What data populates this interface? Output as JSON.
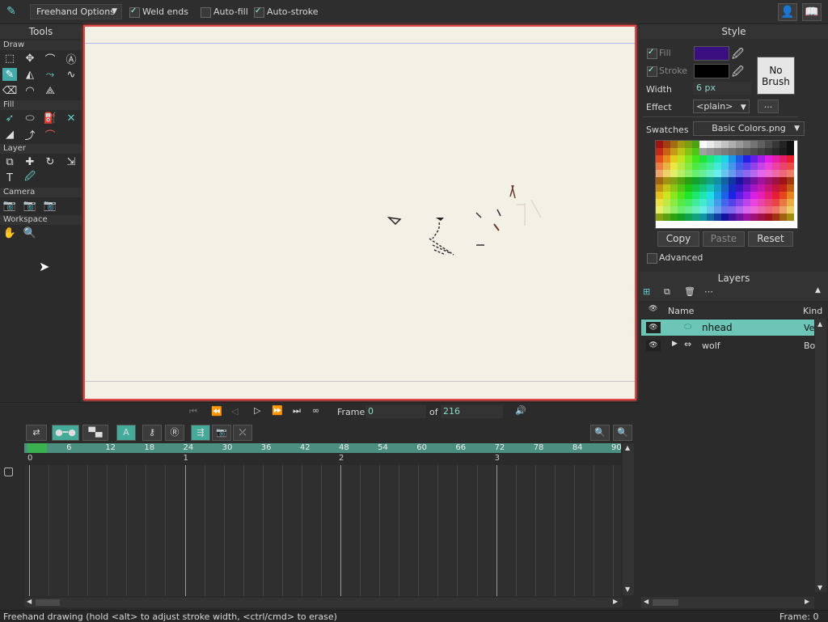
{
  "toolbar": {
    "options": "Freehand Options",
    "weld": "Weld ends",
    "autofill": "Auto-fill",
    "autostroke": "Auto-stroke"
  },
  "tools": {
    "title": "Tools",
    "draw": "Draw",
    "fill": "Fill",
    "layer": "Layer",
    "camera": "Camera",
    "workspace": "Workspace"
  },
  "style": {
    "title": "Style",
    "fill": "Fill",
    "stroke": "Stroke",
    "width_label": "Width",
    "width": "6 px",
    "effect_label": "Effect",
    "effect": "<plain>",
    "effect_more": "...",
    "no_brush": "No Brush",
    "swatches_label": "Swatches",
    "swatches": "Basic Colors.png",
    "copy": "Copy",
    "paste": "Paste",
    "reset": "Reset",
    "advanced": "Advanced",
    "fill_color": "#3a1080",
    "stroke_color": "#000000"
  },
  "layers": {
    "title": "Layers",
    "col_name": "Name",
    "col_kind": "Kind",
    "rows": [
      {
        "name": "nhead",
        "kind": "Ve"
      },
      {
        "name": "wolf",
        "kind": "Bo"
      }
    ]
  },
  "playback": {
    "frame_label": "Frame",
    "frame": "0",
    "of_label": "of",
    "total": "216"
  },
  "timeline": {
    "ticks": [
      "0",
      "6",
      "12",
      "18",
      "24",
      "30",
      "36",
      "42",
      "48",
      "54",
      "60",
      "66",
      "72",
      "78",
      "84",
      "90"
    ],
    "seconds": [
      "0",
      "1",
      "2",
      "3"
    ]
  },
  "status": {
    "left": "Freehand drawing (hold <alt> to adjust stroke width, <ctrl/cmd> to erase)",
    "right": "Frame: 0"
  }
}
